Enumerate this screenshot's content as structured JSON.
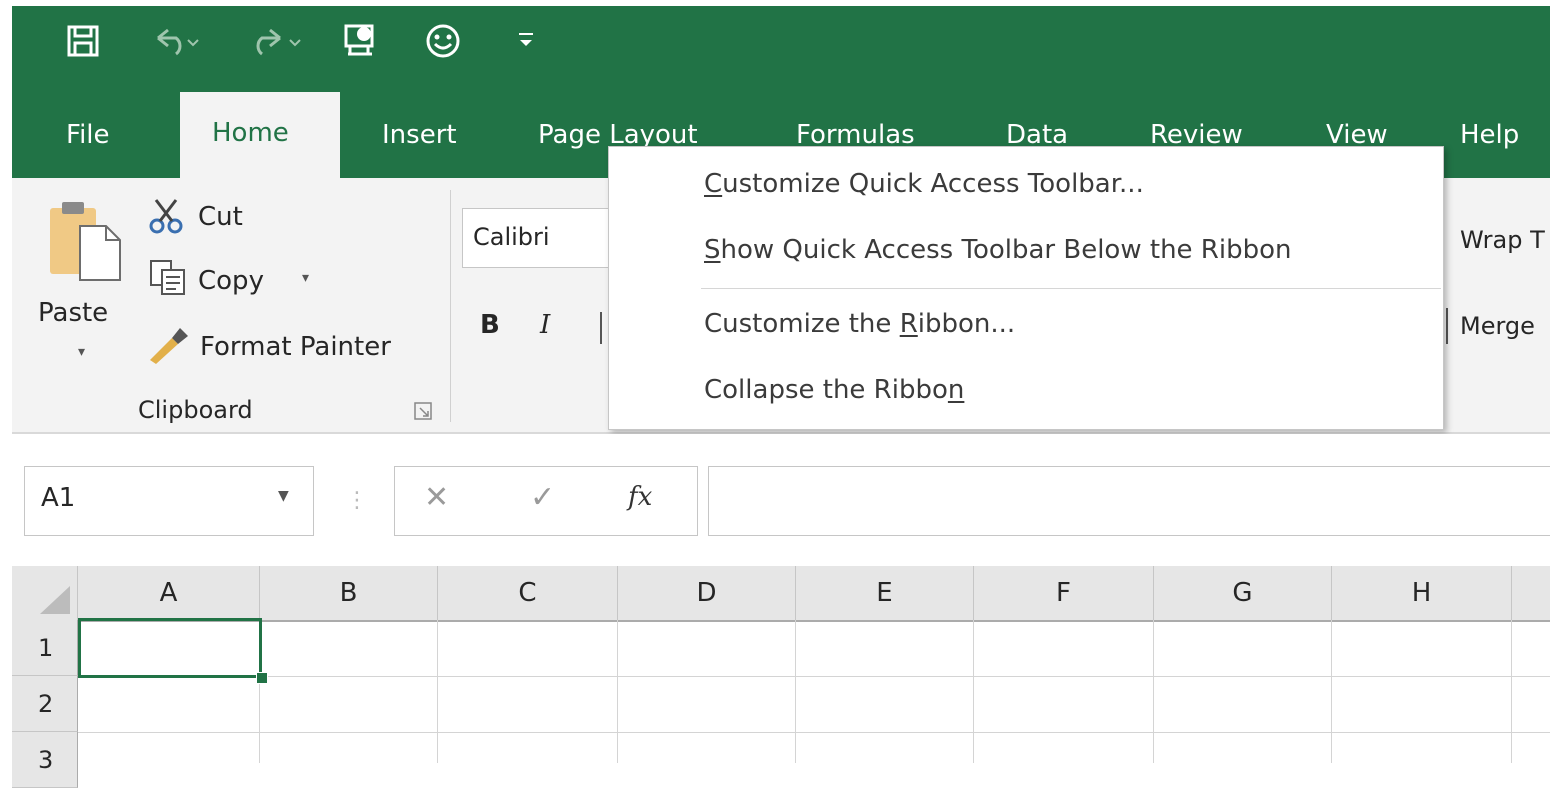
{
  "quick_access": {
    "icons": [
      "save-icon",
      "undo-icon",
      "redo-icon",
      "touch-mode-icon",
      "feedback-smiley-icon",
      "customize-qat-icon"
    ]
  },
  "tabs": {
    "file": "File",
    "home": "Home",
    "insert": "Insert",
    "page_layout": "Page Layout",
    "formulas": "Formulas",
    "data": "Data",
    "review": "Review",
    "view": "View",
    "help": "Help"
  },
  "clipboard": {
    "paste": "Paste",
    "cut": "Cut",
    "copy": "Copy",
    "format_painter": "Format Painter",
    "group_label": "Clipboard"
  },
  "font": {
    "name": "Calibri",
    "bold": "B",
    "italic": "I"
  },
  "alignment": {
    "wrap": "Wrap T",
    "merge": "Merge"
  },
  "context_menu": {
    "item1_key": "C",
    "item1_rest": "ustomize Quick Access Toolbar...",
    "item2_key": "S",
    "item2_rest": "how Quick Access Toolbar Below the Ribbon",
    "item3_pre": "Customize the ",
    "item3_key": "R",
    "item3_rest": "ibbon...",
    "item4_pre": "Collapse the Ribbo",
    "item4_key": "n"
  },
  "formula_bar": {
    "name_box": "A1",
    "cancel": "✕",
    "enter": "✓",
    "fx": "fx"
  },
  "grid": {
    "columns": [
      "A",
      "B",
      "C",
      "D",
      "E",
      "F",
      "G",
      "H"
    ],
    "rows": [
      "1",
      "2",
      "3"
    ],
    "selected_cell": "A1"
  },
  "colors": {
    "excel_green": "#217346",
    "ribbon_bg": "#f3f3f3"
  }
}
